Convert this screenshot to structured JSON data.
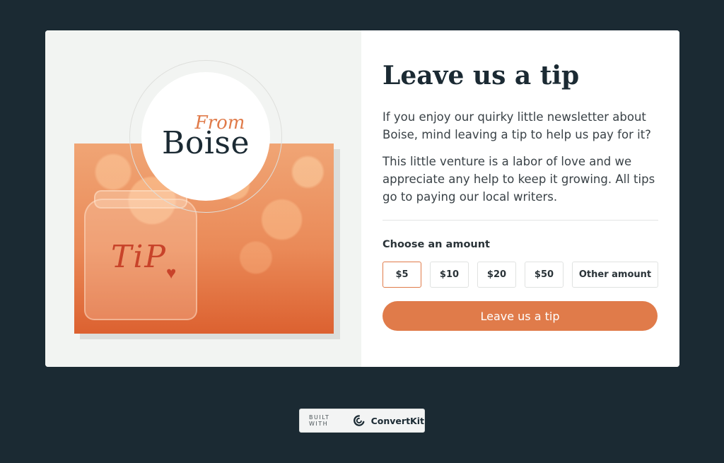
{
  "logo": {
    "from_text": "From",
    "name_text": "Boise"
  },
  "photo": {
    "jar_text": "TiP",
    "heart": "♥"
  },
  "form": {
    "title": "Leave us a tip",
    "paragraph_1": "If you enjoy our quirky little newsletter about Boise, mind leaving a tip to help us pay for it?",
    "paragraph_2": "This little venture is a labor of love and we appreciate any help to keep it growing. All tips go to paying our local writers.",
    "choose_label": "Choose an amount",
    "amounts": [
      "$5",
      "$10",
      "$20",
      "$50",
      "Other amount"
    ],
    "selected_amount": "$5",
    "submit_label": "Leave us a tip"
  },
  "footer": {
    "built_with": "BUILT WITH",
    "brand": "ConvertKit"
  },
  "colors": {
    "background": "#1b2a33",
    "accent": "#e07b4a",
    "text_dark": "#1b2a33"
  }
}
